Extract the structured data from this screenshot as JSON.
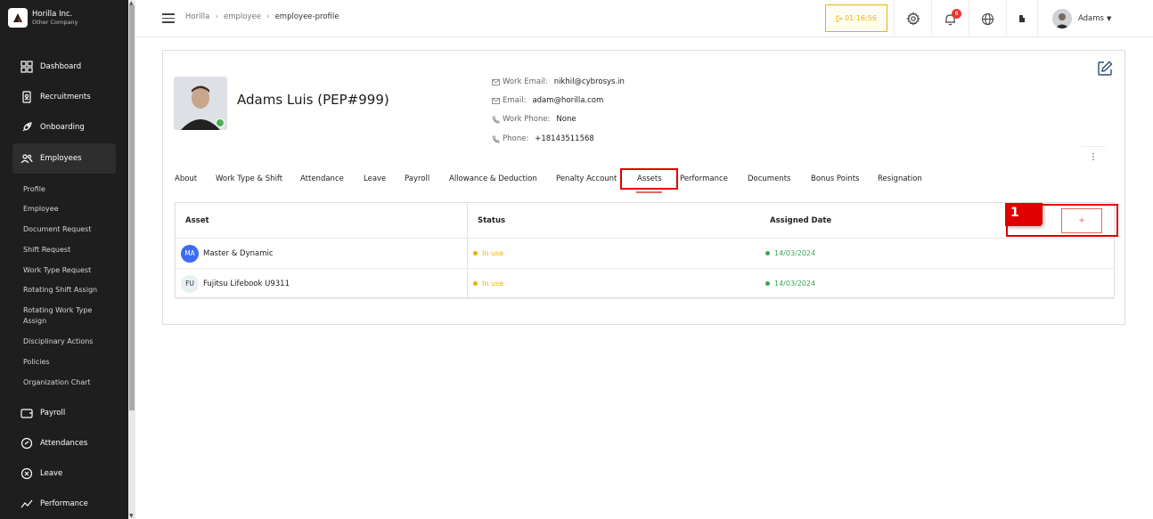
{
  "brand": {
    "name": "Horilla Inc.",
    "company": "Other Company"
  },
  "sidebar": {
    "items": [
      {
        "label": "Dashboard",
        "icon": "dashboard-grid-icon"
      },
      {
        "label": "Recruitments",
        "icon": "recruitment-icon"
      },
      {
        "label": "Onboarding",
        "icon": "rocket-icon"
      },
      {
        "label": "Employees",
        "icon": "users-icon"
      },
      {
        "label": "Payroll",
        "icon": "wallet-icon"
      },
      {
        "label": "Attendances",
        "icon": "attendance-icon"
      },
      {
        "label": "Leave",
        "icon": "leave-icon"
      },
      {
        "label": "Performance",
        "icon": "performance-icon"
      }
    ],
    "sub_items": [
      "Profile",
      "Employee",
      "Document Request",
      "Shift Request",
      "Work Type Request",
      "Rotating Shift Assign",
      "Rotating Work Type Assign",
      "Disciplinary Actions",
      "Policies",
      "Organization Chart"
    ]
  },
  "header": {
    "breadcrumbs": [
      "Horilla",
      "employee",
      "employee-profile"
    ],
    "breadcrumb_sep": "›",
    "timer": "01:16:56",
    "notification_count": "8",
    "user_name": "Adams"
  },
  "profile": {
    "name": "Adams Luis (PEP#999)",
    "contacts": [
      {
        "label": "Work Email:",
        "value": "nikhil@cybrosys.in"
      },
      {
        "label": "Email:",
        "value": "adam@horilla.com"
      },
      {
        "label": "Work Phone:",
        "value": "None"
      },
      {
        "label": "Phone:",
        "value": "+18143511568"
      }
    ]
  },
  "tabs": [
    "About",
    "Work Type & Shift",
    "Attendance",
    "Leave",
    "Payroll",
    "Allowance & Deduction",
    "Penalty Account",
    "Assets",
    "Performance",
    "Documents",
    "Bonus Points",
    "Resignation"
  ],
  "active_tab": "Assets",
  "assets_table": {
    "headers": {
      "asset": "Asset",
      "status": "Status",
      "assigned_date": "Assigned Date"
    },
    "add_label": "+",
    "rows": [
      {
        "initials": "MA",
        "name": "Master & Dynamic",
        "status": "In use",
        "date": "14/03/2024"
      },
      {
        "initials": "FU",
        "name": "Fujitsu Lifebook U9311",
        "status": "In use",
        "date": "14/03/2024"
      }
    ]
  },
  "annotation": {
    "step": "1"
  },
  "colors": {
    "sidebar_bg": "#1e1e1e",
    "accent": "#e06a5a",
    "timer": "#e8b300",
    "status_in_use": "#e8b300",
    "date_green": "#3ba55c",
    "highlight": "#e00000"
  }
}
